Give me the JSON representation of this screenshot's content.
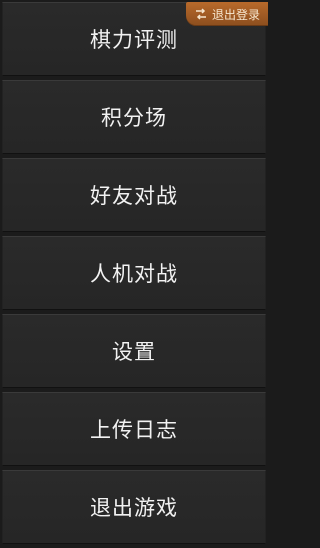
{
  "top_right": {
    "logout_label": "退出登录",
    "icon": "swap-icon"
  },
  "menu": {
    "items": [
      {
        "label": "棋力评测"
      },
      {
        "label": "积分场"
      },
      {
        "label": "好友对战"
      },
      {
        "label": "人机对战"
      },
      {
        "label": "设置"
      },
      {
        "label": "上传日志"
      },
      {
        "label": "退出游戏"
      }
    ]
  },
  "colors": {
    "background": "#1b1b1b",
    "menu_item": "#2a2a2a",
    "badge": "#b86a2b",
    "text": "#f2f2f2"
  }
}
